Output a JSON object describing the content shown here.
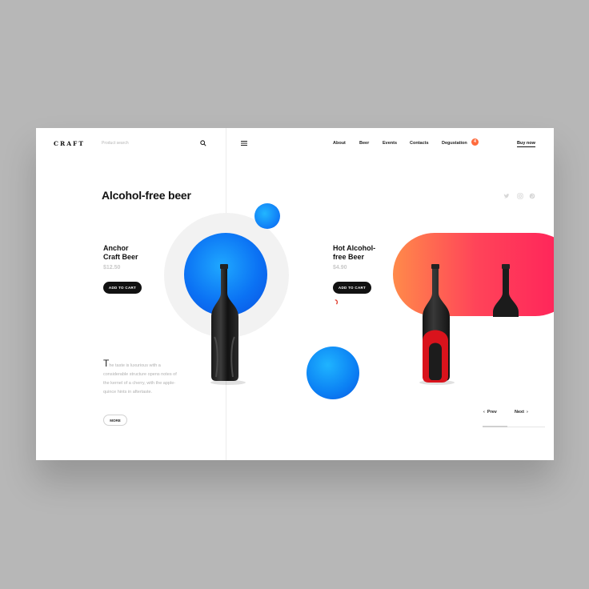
{
  "brand": {
    "logo_text": "CRAFT"
  },
  "search": {
    "placeholder": "Product search"
  },
  "nav": {
    "items": [
      {
        "label": "About"
      },
      {
        "label": "Beer"
      },
      {
        "label": "Events"
      },
      {
        "label": "Contacts"
      },
      {
        "label": "Degustation"
      }
    ],
    "degustation_badge": "4",
    "buy_now": "Buy now"
  },
  "page": {
    "title": "Alcohol-free beer"
  },
  "social_icons": [
    "twitter-icon",
    "instagram-icon",
    "pinterest-icon"
  ],
  "products": [
    {
      "name_line1": "Anchor",
      "name_line2": "Craft Beer",
      "price": "$12.50",
      "add_label": "ADD TO CART",
      "accent": "#0b72f4"
    },
    {
      "name_line1": "Hot Alcohol-",
      "name_line2": "free Beer",
      "price": "$4.90",
      "add_label": "ADD TO CART",
      "accent": "#ff3355"
    }
  ],
  "description": {
    "initial": "T",
    "text": "he taste is luxurious with a considerable structure opens notes of the kernel of a cherry, with the apple-quince hints in aftertaste.",
    "more_label": "MORE"
  },
  "pager": {
    "prev": "Prev",
    "next": "Next"
  },
  "colors": {
    "background": "#b7b7b7",
    "card": "#ffffff",
    "blue": "#0b72f4",
    "red": "#ff3355",
    "orange": "#ff8a4a"
  }
}
